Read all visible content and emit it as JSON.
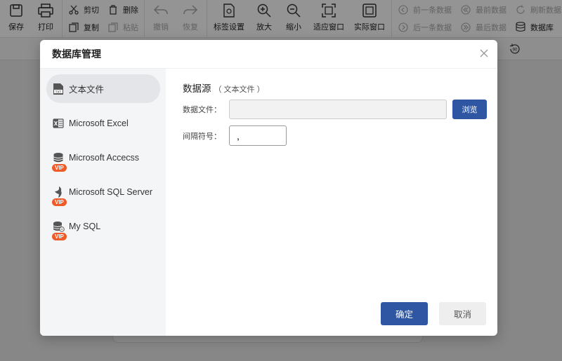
{
  "toolbar": {
    "save": "保存",
    "print": "打印",
    "cut": "剪切",
    "copy": "复制",
    "delete": "删除",
    "paste": "粘贴",
    "undo": "撤销",
    "redo": "恢复",
    "label_settings": "标签设置",
    "zoom_in": "放大",
    "zoom_out": "缩小",
    "fit_window": "适应窗口",
    "actual_window": "实际窗口",
    "prev_record": "前一条数据",
    "next_record": "后一条数据",
    "first_record": "最前数据",
    "last_record": "最后数据",
    "refresh_data": "刷新数据",
    "database": "数据库",
    "rotate_value": "90"
  },
  "dialog": {
    "title": "数据库管理",
    "sources": [
      {
        "label": "文本文件",
        "icon": "txt-file-icon",
        "vip": ""
      },
      {
        "label": "Microsoft Excel",
        "icon": "excel-icon",
        "vip": ""
      },
      {
        "label": "Microsoft Accecss",
        "icon": "database-icon",
        "vip": "VIP"
      },
      {
        "label": "Microsoft SQL Server",
        "icon": "sql-server-icon",
        "vip": "VIP"
      },
      {
        "label": "My SQL",
        "icon": "mysql-icon",
        "vip": "VIP"
      }
    ],
    "heading": "数据源",
    "heading_sub": "（ 文本文件 ）",
    "data_file_label": "数据文件：",
    "data_file_value": "",
    "browse": "浏览",
    "separator_label": "间隔符号：",
    "separator_value": ",",
    "ok": "确定",
    "cancel": "取消"
  },
  "colors": {
    "primary": "#2e56a3",
    "vip": "#f05a28"
  }
}
